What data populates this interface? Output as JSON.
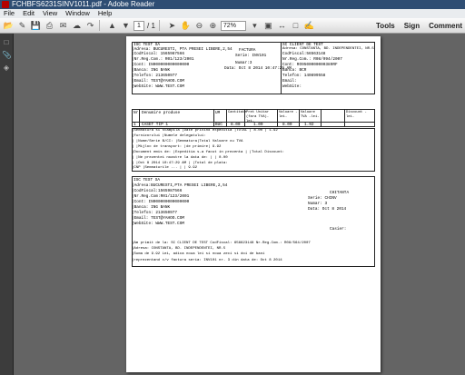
{
  "window": {
    "title": "FCHBFS6231SINV1011.pdf - Adobe Reader"
  },
  "menu": [
    "File",
    "Edit",
    "View",
    "Window",
    "Help"
  ],
  "toolbar": {
    "page_current": "1",
    "page_total": "/ 1",
    "zoom": "72%",
    "tools": "Tools",
    "sign": "Sign",
    "comment": "Comment"
  },
  "invoice": {
    "supplier": [
      "ISC TEST SA",
      "|Adresa: BUCURESTI, PTA PRESEI LIBERE,2,54",
      "|CodFiscal: 1565987566",
      "|Nr.Reg.Com.: R01/123/2001",
      "|Cont:     IN000000000000000",
      "|Banca:    ING BANK",
      "|Telefon:  213650977",
      "|Email:    TEST@YAHOO.COM",
      "|WebSite:  WWW.TEST.COM"
    ],
    "factura_block": [
      "FACTURA",
      "Serie:   INV101",
      "Numar:3",
      "Data: Oct 8 2014 10:47:29 AM"
    ],
    "client": [
      "SC CLIENT DE TEST",
      "Adresa: CONSTANTA, BD. INDEPENDENTEI, NR.5",
      "CodFiscal:56563148",
      "Nr.Reg.Com.: R08/994/2007",
      "Cont:    RO9500000000389RF",
      "Banca:   BCR",
      "Telefon: 140899558",
      "Email:",
      "WebSite:"
    ],
    "table_headers": [
      "Nr.",
      "Denumire produse",
      "UM",
      "Cantitate",
      "Pret Unitar (fara TVA)-lei-",
      "Valoare -lei-",
      "Valoare TVA -lei-",
      "Discount -lei-"
    ],
    "table_row": [
      "1",
      "CASET TIP 1",
      "BUC",
      "8.00",
      "1.00",
      "8.00",
      "1.92",
      ""
    ],
    "footer_rows": [
      "|Semnatura si stampila   |Date privind expeditia                  |TOTAL   | 8.00   | 1.92",
      "|furnizorului            |Numele delegatului:",
      "|                        |Nume/Serie B/CI:                        |Semnatura|Total Valoare cu TVA",
      "|                        |Mijloc de transport:                    |de primire|   9.92",
      "|Document emis de:       |Expeditia s-a facut in prezenta          |         |Total Discount:",
      "|                        |Ne prezentei noastre la data de:          |         |   0.00",
      "|                        |Oct 8 2014 10:47:29 AM                  |         |Total de plata:",
      "|CNP                     |Semnaturile ...                          |         |   9.92"
    ],
    "chitanta_supplier": [
      "ISC TEST SA",
      "|Adresa:BUCURESTI,PTA PRESEI LIBERE,2,54",
      "|CodFiscal:1565987566",
      "|Nr.Reg.Com:R01/123/2001",
      "|Cont:    IN000000000000000",
      "|Banca:   ING BANK",
      "|Telefon: 213650977",
      "|Email:   TEST@YAHOO.COM",
      "|WebSite: WWW.TEST.COM"
    ],
    "chitanta_block": [
      "CHITANTA",
      "Serie:      CHINV",
      "Numar:      3",
      "Data:  Oct 8 2014",
      "",
      "",
      "Casier:"
    ],
    "chitanta_body": [
      "|Am primit de la: SC CLIENT DE TEST  CodFiscal:  656623148        Nr.Reg.Com.:  R08/564/2007",
      "|Adresa:       CONSTANTA, BD. INDEPENDENTEI, NR.5",
      "|Suma de       9.92        Lei, adica   noua lei si noua zeci si doi de bani",
      "|reprezentand c/v factura seria:        INV101     nr.      3     din data de:  Oct 8 2014"
    ]
  }
}
